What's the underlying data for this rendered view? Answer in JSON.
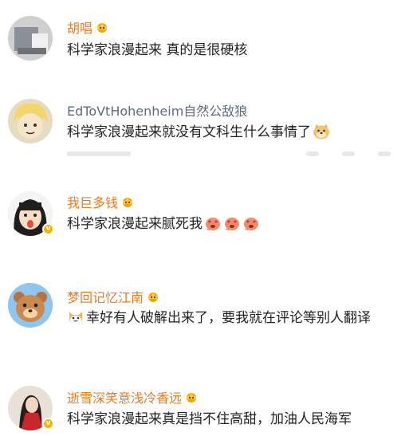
{
  "comments": [
    {
      "name": "胡唱",
      "text": "科学家浪漫起来 真的是很硬核"
    },
    {
      "name": "EdToVtHohenheim自然公敌狼",
      "text": "科学家浪漫起来就没有文科生什么事情了"
    },
    {
      "name": "我巨多钱",
      "text": "科学家浪漫起来腻死我"
    },
    {
      "name": "梦回记忆江南",
      "text": "幸好有人破解出来了，要我就在评论等别人翻译"
    },
    {
      "name": "逝雪深笑意浅冷香远",
      "text": "科学家浪漫起来真是挡不住高甜，加油人民海军"
    }
  ],
  "icons": {
    "vip_badge": "crown-icon",
    "verified_badge": "v-badge-icon",
    "emoji_doge": "doge-emoji",
    "emoji_love": "love-emoji",
    "emoji_cat": "cat-emoji"
  },
  "colors": {
    "vip_name": "#ea7b1f",
    "plain_name": "#5d6b82",
    "text": "#222222"
  }
}
